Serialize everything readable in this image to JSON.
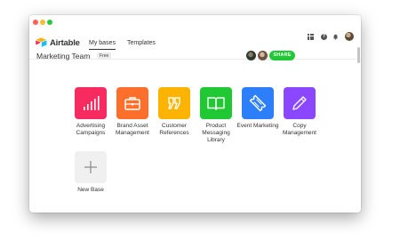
{
  "app": {
    "name": "Airtable"
  },
  "nav": {
    "tabs": [
      {
        "label": "My bases",
        "active": true
      },
      {
        "label": "Templates",
        "active": false
      }
    ],
    "help_glyph": "?"
  },
  "workspace": {
    "title": "Marketing Team",
    "plan_badge": "Free",
    "share_label": "SHARE"
  },
  "bases": [
    {
      "label": "Advertising Campaigns",
      "color": "#f82b60",
      "icon": "bar-chart-icon"
    },
    {
      "label": "Brand Asset Management",
      "color": "#ff6f2c",
      "icon": "briefcase-icon"
    },
    {
      "label": "Customer References",
      "color": "#fcb400",
      "icon": "quote-icon"
    },
    {
      "label": "Product Messaging Library",
      "color": "#20c933",
      "icon": "book-icon"
    },
    {
      "label": "Event Marketing",
      "color": "#2d7ff9",
      "icon": "ticket-icon"
    },
    {
      "label": "Copy Management",
      "color": "#8b46ff",
      "icon": "pencil-icon"
    }
  ],
  "new_base": {
    "label": "New Base",
    "icon": "plus-icon"
  },
  "colors": {
    "share_green": "#20c933",
    "traffic_close": "#fe5f57",
    "traffic_min": "#febc2e",
    "traffic_max": "#28c840"
  }
}
